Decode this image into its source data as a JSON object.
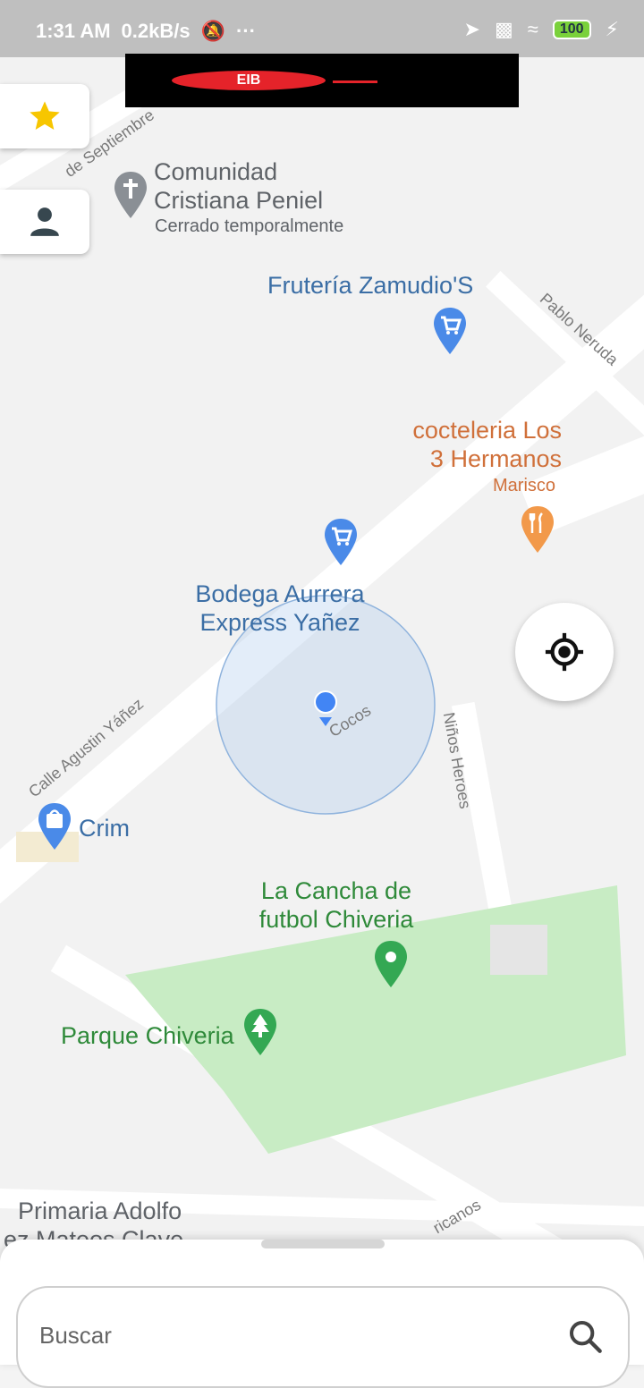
{
  "status_bar": {
    "time": "1:31 AM",
    "speed": "0.2kB/s",
    "battery": "100"
  },
  "ad_banner": {
    "text": "EIB"
  },
  "map_labels": {
    "comunidad_line1": "Comunidad",
    "comunidad_line2": "Cristiana Peniel",
    "comunidad_sub": "Cerrado temporalmente",
    "fruteria": "Frutería Zamudio'S",
    "cocteleria_line1": "cocteleria Los",
    "cocteleria_line2": "3 Hermanos",
    "cocteleria_sub": "Marisco",
    "bodega_line1": "Bodega Aurrera",
    "bodega_line2": "Express Yañez",
    "crim": "Crim",
    "cancha_line1": "La Cancha de",
    "cancha_line2": "futbol Chiveria",
    "parque": "Parque Chiveria",
    "primaria_line1": "Primaria Adolfo",
    "primaria_line2": "ez Mateos Clave"
  },
  "streets": {
    "septiembre": "de Septiembre",
    "pablo": "Pablo Neruda",
    "agustin": "Calle Agustin Yáñez",
    "ninos": "Niños Heroes",
    "cocos": "Cocos",
    "bottom": "ricanos"
  },
  "search": {
    "placeholder": "Buscar"
  },
  "colors": {
    "accent_blue": "#4285f4",
    "poi_blue": "#3b6ea5",
    "poi_orange": "#d0703a",
    "park_green": "#c8ecc4"
  }
}
